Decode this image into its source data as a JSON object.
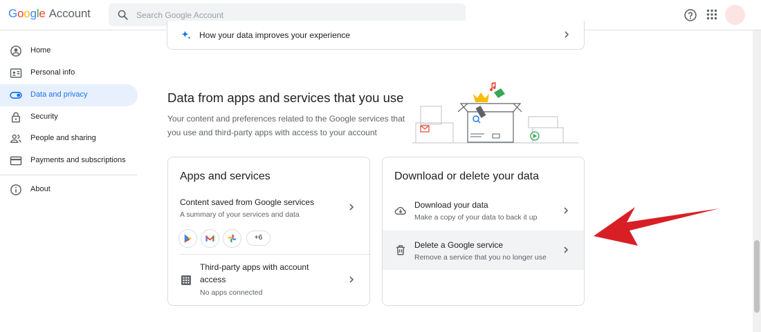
{
  "header": {
    "logo_google": [
      "G",
      "o",
      "o",
      "g",
      "l",
      "e"
    ],
    "logo_account": "Account",
    "search_placeholder": "Search Google Account",
    "avatar_color": "#fce4e2"
  },
  "sidebar": {
    "items": [
      {
        "label": "Home",
        "icon": "account-circle-icon"
      },
      {
        "label": "Personal info",
        "icon": "id-card-icon"
      },
      {
        "label": "Data and privacy",
        "icon": "toggle-icon",
        "active": true
      },
      {
        "label": "Security",
        "icon": "lock-icon"
      },
      {
        "label": "People and sharing",
        "icon": "people-icon"
      },
      {
        "label": "Payments and subscriptions",
        "icon": "credit-card-icon"
      }
    ],
    "about": {
      "label": "About",
      "icon": "info-icon"
    }
  },
  "main": {
    "top_row": {
      "label": "How your data improves your experience"
    },
    "section": {
      "title": "Data from apps and services that you use",
      "description": "Your content and preferences related to the Google services that you use and third-party apps with access to your account"
    },
    "apps_card": {
      "title": "Apps and services",
      "content_saved": {
        "title": "Content saved from Google services",
        "subtitle": "A summary of your services and data"
      },
      "services": [
        "Google Play",
        "Gmail",
        "Google Photos"
      ],
      "more_count": "+6",
      "third_party": {
        "title_line1": "Third-party apps with account",
        "title_line2": "access",
        "subtitle": "No apps connected"
      }
    },
    "download_card": {
      "title": "Download or delete your data",
      "download": {
        "title": "Download your data",
        "subtitle": "Make a copy of your data to back it up"
      },
      "delete": {
        "title": "Delete a Google service",
        "subtitle": "Remove a service that you no longer use"
      }
    }
  },
  "colors": {
    "accent": "#1a73e8",
    "active_bg": "#e8f0fe",
    "arrow": "#d81f26"
  }
}
